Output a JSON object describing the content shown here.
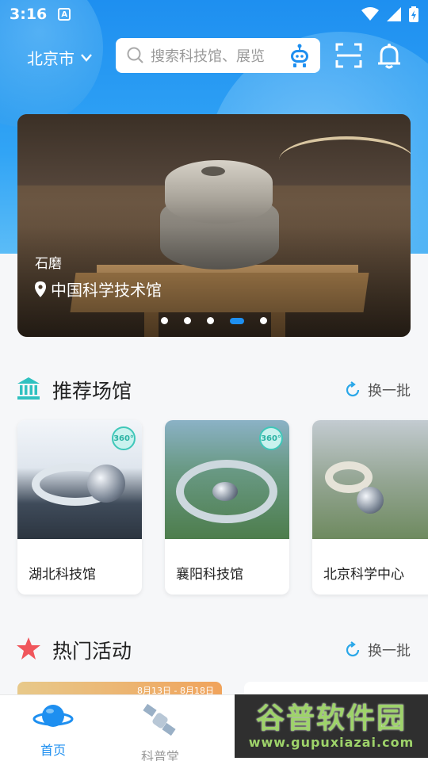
{
  "status": {
    "time": "3:16"
  },
  "header": {
    "city": "北京市",
    "search_placeholder": "搜索科技馆、展览"
  },
  "banner": {
    "title": "石磨",
    "location": "中国科学技术馆",
    "dots_count": 5,
    "active_index": 3
  },
  "recommended": {
    "title": "推荐场馆",
    "refresh_label": "换一批",
    "venues": [
      {
        "name": "湖北科技馆",
        "badge": "360°"
      },
      {
        "name": "襄阳科技馆",
        "badge": "360°"
      },
      {
        "name": "北京科学中心"
      }
    ]
  },
  "hot_activities": {
    "title": "热门活动",
    "refresh_label": "换一批",
    "card1_date": "8月13日 - 8月18日"
  },
  "tabbar": {
    "tabs": [
      {
        "label": "首页",
        "active": true
      },
      {
        "label": "科普堂",
        "active": false
      }
    ]
  },
  "watermark": {
    "title": "谷普软件园",
    "url": "www.gupuxiazai.com"
  },
  "colors": {
    "primary": "#1e8ff0",
    "accent_teal": "#3fc7b9",
    "star": "#f0565c"
  }
}
